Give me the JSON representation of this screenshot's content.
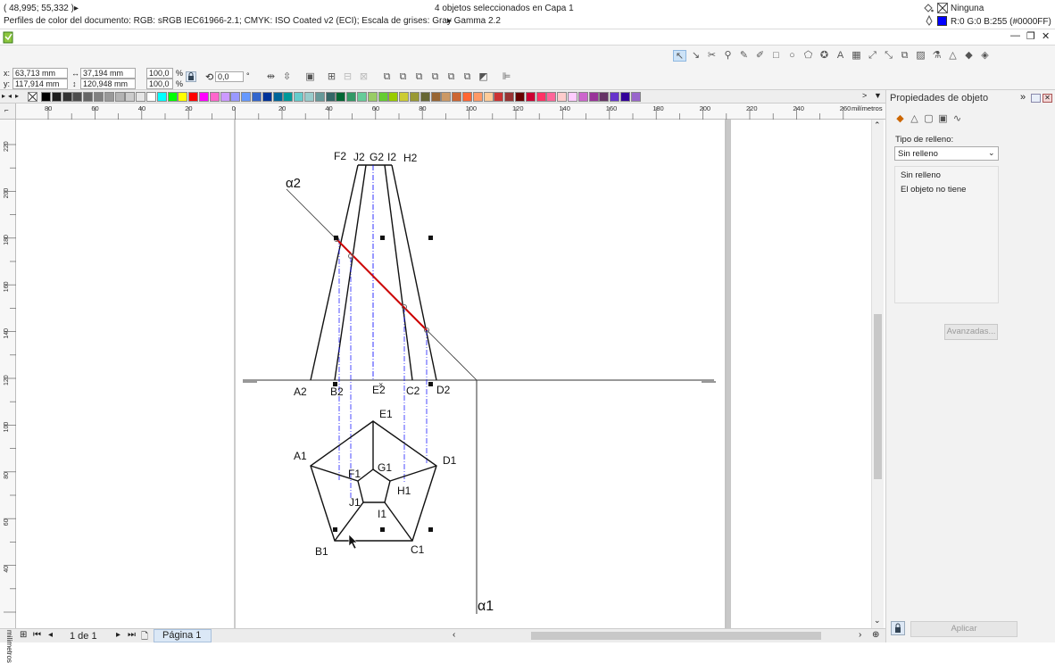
{
  "status": {
    "coords": "( 48,995; 55,332 )",
    "arrow": "▸",
    "selection": "4 objetos seleccionados en Capa 1",
    "color_profiles": "Perfiles de color del documento: RGB: sRGB IEC61966-2.1; CMYK: ISO Coated v2 (ECI); Escala de grises: Gray Gamma 2.2",
    "fill_status": "Ninguna",
    "outline_status": "R:0 G:0 B:255 (#0000FF)",
    "outline_color": "#0000FF"
  },
  "window": {
    "minimize": "—",
    "restore": "❐",
    "close": "✕"
  },
  "props": {
    "x_label": "x:",
    "x_value": "63,713 mm",
    "y_label": "y:",
    "y_value": "117,914 mm",
    "width_value": "37,194 mm",
    "height_value": "120,948 mm",
    "scale_w": "100,0",
    "scale_h": "100,0",
    "pct": "%",
    "angle_value": "0,0",
    "deg": "°"
  },
  "palette": {
    "colors": [
      "#000000",
      "#1c1c1c",
      "#333333",
      "#4d4d4d",
      "#666666",
      "#808080",
      "#999999",
      "#b3b3b3",
      "#cccccc",
      "#e6e6e6",
      "#ffffff",
      "#00ffff",
      "#00ff00",
      "#ffff00",
      "#ff0000",
      "#ff00ff",
      "#ff66cc",
      "#cc99ff",
      "#9999ff",
      "#6699ff",
      "#3366cc",
      "#003399",
      "#006699",
      "#009999",
      "#66cccc",
      "#99cccc",
      "#669999",
      "#336666",
      "#006633",
      "#339966",
      "#66cc99",
      "#99cc66",
      "#66cc33",
      "#99cc00",
      "#cccc33",
      "#999933",
      "#666633",
      "#996633",
      "#cc9966",
      "#cc6633",
      "#ff6633",
      "#ff9966",
      "#ffcc99",
      "#cc3333",
      "#993333",
      "#660000",
      "#cc0033",
      "#ff3366",
      "#ff6699",
      "#ffcccc",
      "#ffccff",
      "#cc66cc",
      "#993399",
      "#663366",
      "#6633cc",
      "#330099",
      "#9966cc"
    ]
  },
  "ruler": {
    "unit": "milímetros",
    "h_labels": [
      "80",
      "60",
      "40",
      "20",
      "0",
      "20",
      "40",
      "60",
      "80",
      "100",
      "120",
      "140",
      "160",
      "180",
      "200",
      "220",
      "240",
      "260"
    ],
    "v_labels": [
      "220",
      "200",
      "180",
      "160",
      "140",
      "120",
      "100",
      "80",
      "60",
      "40"
    ],
    "v_unit": "milímetros"
  },
  "drawing": {
    "labels": {
      "F2": "F2",
      "J2": "J2",
      "G2": "G2",
      "I2": "I2",
      "H2": "H2",
      "alpha2": "α2",
      "A2": "A2",
      "B2": "B2",
      "E2": "E2",
      "C2": "C2",
      "D2": "D2",
      "E1": "E1",
      "A1": "A1",
      "D1": "D1",
      "F1": "F1",
      "G1": "G1",
      "H1": "H1",
      "J1": "J1",
      "I1": "I1",
      "B1": "B1",
      "C1": "C1",
      "alpha1": "α1"
    },
    "section_color": "#cc0000",
    "projection_color": "#0000ff"
  },
  "panel": {
    "title": "Propiedades de objeto",
    "fill_type_label": "Tipo de relleno:",
    "fill_type_value": "Sin relleno",
    "group_title": "Sin relleno",
    "group_text": "El objeto no tiene",
    "advanced_button": "Avanzadas...",
    "apply_button": "Aplicar"
  },
  "bottom": {
    "page_count": "1 de 1",
    "page_tab": "Página 1"
  }
}
